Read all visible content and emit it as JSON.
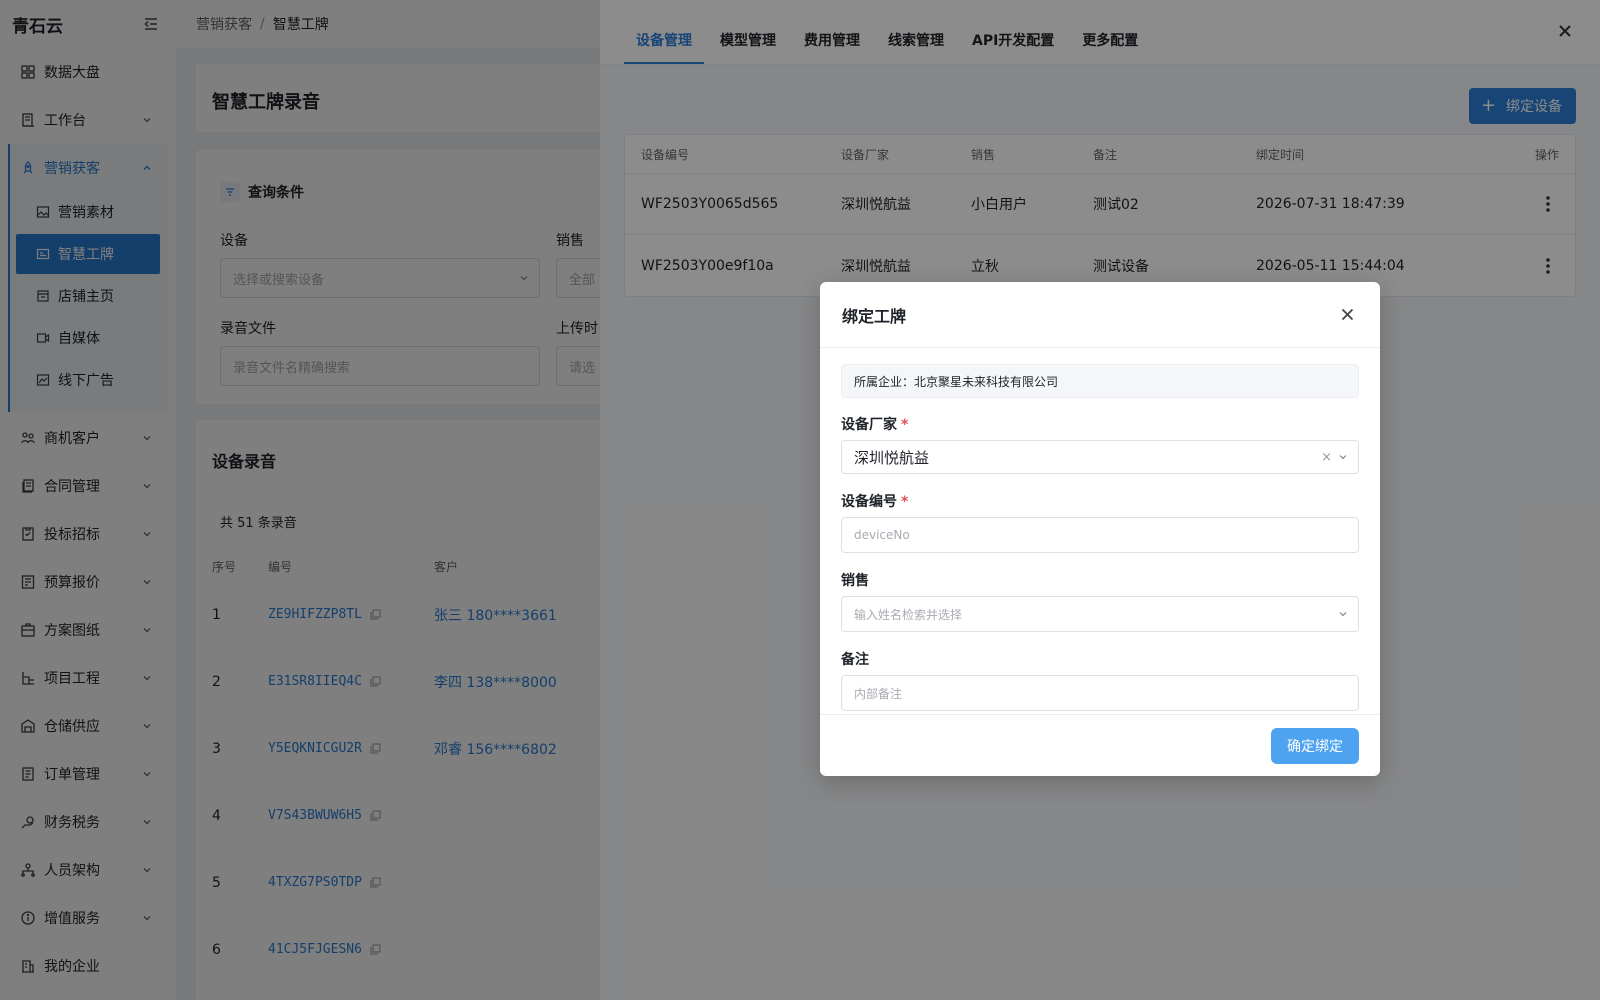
{
  "app": {
    "brand": "青石云"
  },
  "sidebar": {
    "items": [
      {
        "label": "数据大盘",
        "icon": "dashboard-icon"
      },
      {
        "label": "工作台",
        "icon": "workbench-icon"
      },
      {
        "label": "营销获客",
        "icon": "rocket-icon"
      },
      {
        "label": "商机客户",
        "icon": "users-icon"
      },
      {
        "label": "合同管理",
        "icon": "contract-icon"
      },
      {
        "label": "投标招标",
        "icon": "bid-icon"
      },
      {
        "label": "预算报价",
        "icon": "budget-icon"
      },
      {
        "label": "方案图纸",
        "icon": "blueprint-icon"
      },
      {
        "label": "项目工程",
        "icon": "project-icon"
      },
      {
        "label": "仓储供应",
        "icon": "warehouse-icon"
      },
      {
        "label": "订单管理",
        "icon": "order-icon"
      },
      {
        "label": "财务税务",
        "icon": "finance-icon"
      },
      {
        "label": "人员架构",
        "icon": "org-icon"
      },
      {
        "label": "增值服务",
        "icon": "info-icon"
      },
      {
        "label": "我的企业",
        "icon": "enterprise-icon"
      }
    ],
    "marketing_sub": [
      {
        "label": "营销素材",
        "icon": "image-icon"
      },
      {
        "label": "智慧工牌",
        "icon": "badge-icon"
      },
      {
        "label": "店铺主页",
        "icon": "store-icon"
      },
      {
        "label": "自媒体",
        "icon": "video-icon"
      },
      {
        "label": "线下广告",
        "icon": "ad-icon"
      }
    ]
  },
  "breadcrumb": {
    "parent": "营销获客",
    "separator": "/",
    "current": "智慧工牌"
  },
  "page": {
    "title": "智慧工牌录音",
    "query_title": "查询条件",
    "fields": {
      "device_label": "设备",
      "device_placeholder": "选择或搜索设备",
      "sales_label": "销售",
      "sales_placeholder": "全部",
      "file_label": "录音文件",
      "file_placeholder": "录音文件名精确搜索",
      "upload_label": "上传时",
      "upload_placeholder": "请选"
    },
    "records_title": "设备录音",
    "records_count": "共 51 条录音",
    "records_headers": [
      "序号",
      "编号",
      "客户"
    ],
    "records": [
      {
        "idx": "1",
        "code": "ZE9HIFZZP8TL",
        "customer": "张三 180****3661"
      },
      {
        "idx": "2",
        "code": "E31SR8IIEQ4C",
        "customer": "李四 138****8000"
      },
      {
        "idx": "3",
        "code": "Y5EQKNICGU2R",
        "customer": "邓睿 156****6802"
      },
      {
        "idx": "4",
        "code": "V7S43BWUW6H5",
        "customer": ""
      },
      {
        "idx": "5",
        "code": "4TXZG7PS0TDP",
        "customer": ""
      },
      {
        "idx": "6",
        "code": "41CJ5FJGESN6",
        "customer": ""
      }
    ]
  },
  "drawer": {
    "tabs": [
      "设备管理",
      "模型管理",
      "费用管理",
      "线索管理",
      "API开发配置",
      "更多配置"
    ],
    "active_tab": 0,
    "bind_button": "绑定设备",
    "table_headers": [
      "设备编号",
      "设备厂家",
      "销售",
      "备注",
      "绑定时间",
      "操作"
    ],
    "rows": [
      {
        "device_no": "WF2503Y0065d565",
        "vendor": "深圳悦航益",
        "sales": "小白用户",
        "remark": "测试02",
        "bind_time": "2026-07-31 18:47:39"
      },
      {
        "device_no": "WF2503Y00e9f10a",
        "vendor": "深圳悦航益",
        "sales": "立秋",
        "remark": "测试设备",
        "bind_time": "2026-05-11 15:44:04"
      }
    ]
  },
  "modal": {
    "title": "绑定工牌",
    "company_text": "所属企业：北京聚星未来科技有限公司",
    "vendor_label": "设备厂家",
    "vendor_value": "深圳悦航益",
    "device_label": "设备编号",
    "device_placeholder": "deviceNo",
    "sales_label": "销售",
    "sales_placeholder": "输入姓名检索并选择",
    "remark_label": "备注",
    "remark_placeholder": "内部备注",
    "required_mark": "*",
    "clear_glyph": "×",
    "confirm_button": "确定绑定"
  },
  "colors": {
    "accent": "#2b7fd6",
    "overlay": "rgba(0,0,0,0.5)",
    "required": "#e34d59",
    "confirm": "#4da3f0"
  }
}
